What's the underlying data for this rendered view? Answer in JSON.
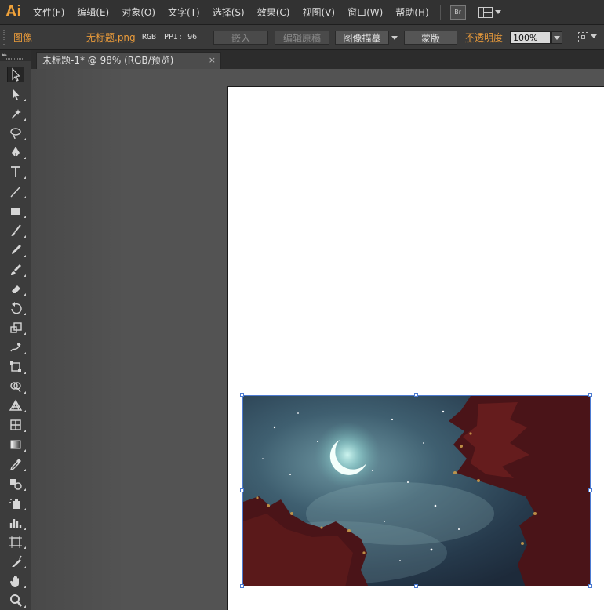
{
  "app": {
    "logo": "Ai"
  },
  "menu": [
    "文件(F)",
    "编辑(E)",
    "对象(O)",
    "文字(T)",
    "选择(S)",
    "效果(C)",
    "视图(V)",
    "窗口(W)",
    "帮助(H)"
  ],
  "menu_extra": {
    "bridge_label": "Br"
  },
  "control": {
    "object_type": "图像",
    "file_name": "无标题.png",
    "color_mode": "RGB",
    "ppi": "PPI: 96",
    "embed_label": "嵌入",
    "edit_original_label": "编辑原稿",
    "image_trace_label": "图像描摹",
    "mask_label": "蒙版",
    "opacity_label": "不透明度",
    "opacity_value": "100%"
  },
  "document_tab": {
    "title": "未标题-1* @ 98% (RGB/预览)",
    "close": "×"
  },
  "tools": [
    "selection-tool",
    "direct-selection-tool",
    "magic-wand-tool",
    "lasso-tool",
    "pen-tool",
    "type-tool",
    "line-segment-tool",
    "rectangle-tool",
    "paintbrush-tool",
    "pencil-tool",
    "blob-brush-tool",
    "eraser-tool",
    "rotate-tool",
    "scale-tool",
    "warp-tool",
    "free-transform-tool",
    "shape-builder-tool",
    "perspective-grid-tool",
    "mesh-tool",
    "gradient-tool",
    "eyedropper-tool",
    "blend-tool",
    "symbol-sprayer-tool",
    "column-graph-tool",
    "artboard-tool",
    "slice-tool",
    "hand-tool",
    "zoom-tool"
  ],
  "colors": {
    "accent": "#e89a3a",
    "selection": "#4d7bd1",
    "artboard": "#ffffff",
    "workspace": "#535353"
  }
}
